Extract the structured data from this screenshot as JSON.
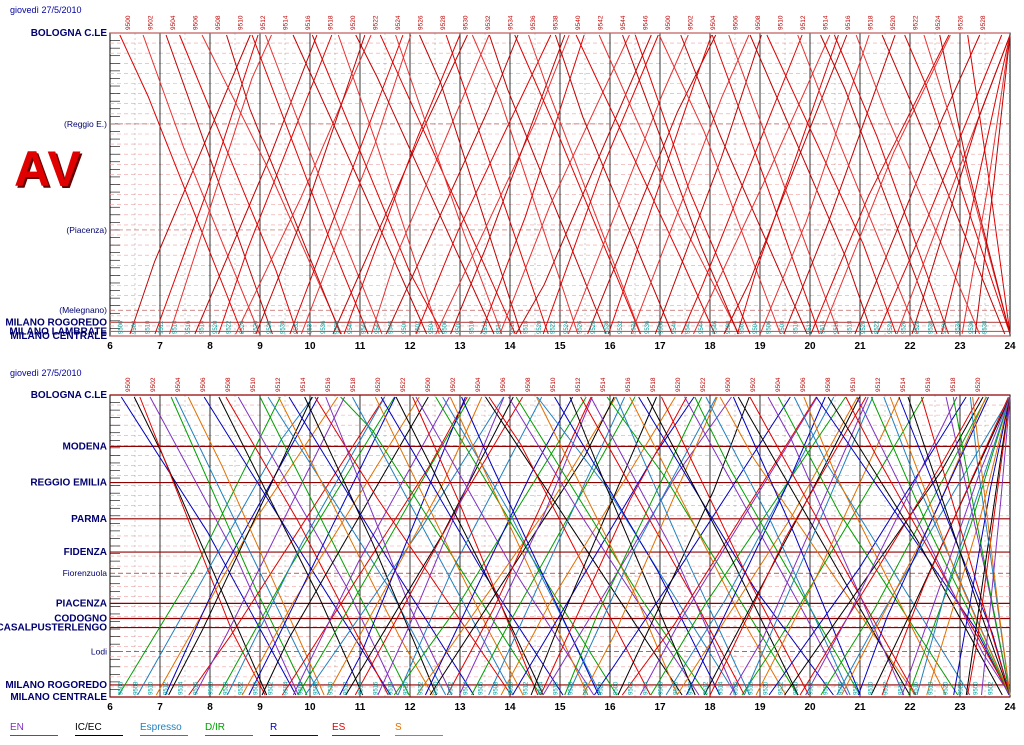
{
  "chart_data": [
    {
      "type": "line",
      "subtype": "train-timetable-diagram",
      "date_label": "giovedì 27/5/2010",
      "badge": "AV",
      "xlabel": "",
      "ylabel": "",
      "x_ticks": [
        "6",
        "7",
        "8",
        "9",
        "10",
        "11",
        "12",
        "13",
        "14",
        "15",
        "16",
        "17",
        "18",
        "19",
        "20",
        "21",
        "22",
        "23",
        "24"
      ],
      "xlim": [
        6,
        24
      ],
      "stations": [
        {
          "name": "BOLOGNA C.LE",
          "km": 0
        },
        {
          "name": "(Reggio E.)",
          "km": 0.3
        },
        {
          "name": "(Piacenza)",
          "km": 0.65
        },
        {
          "name": "(Melegnano)",
          "km": 0.915
        },
        {
          "name": "MILANO ROGOREDO",
          "km": 0.955
        },
        {
          "name": "MILANO LAMBRATE",
          "km": 0.985
        },
        {
          "name": "MILANO CENTRALE",
          "km": 1
        }
      ],
      "series": [
        {
          "name": "ES",
          "color": "#e00000",
          "trips": [
            6.8,
            7.2,
            7.6,
            8.0,
            8.3,
            8.7,
            9.0,
            9.3,
            9.6,
            10.0,
            10.3,
            10.6,
            11.0,
            11.3,
            11.6,
            12.0,
            12.4,
            13.0,
            13.4,
            13.8,
            14.2,
            14.6,
            15.0,
            15.4,
            15.8,
            16.2,
            16.6,
            17.0,
            17.4,
            17.8,
            18.2,
            18.6,
            19.0,
            19.4,
            19.8,
            20.2,
            20.6,
            21.0,
            21.4,
            21.8,
            22.2,
            22.6,
            23.0
          ]
        },
        {
          "name": "R",
          "color": "#2a7fd4",
          "trips": []
        }
      ],
      "train_labels": [
        "9500",
        "9502",
        "9504",
        "9506",
        "9508",
        "9510",
        "9512",
        "9514",
        "9516",
        "9518",
        "9520",
        "9522",
        "9524",
        "9526",
        "9528",
        "9530",
        "9532",
        "9534",
        "9536",
        "9538",
        "9540",
        "9542",
        "9544",
        "9546"
      ],
      "grid": true
    },
    {
      "type": "line",
      "subtype": "train-timetable-diagram",
      "date_label": "giovedì 27/5/2010",
      "x_ticks": [
        "6",
        "7",
        "8",
        "9",
        "10",
        "11",
        "12",
        "13",
        "14",
        "15",
        "16",
        "17",
        "18",
        "19",
        "20",
        "21",
        "22",
        "23",
        "24"
      ],
      "xlim": [
        6,
        24
      ],
      "stations": [
        {
          "name": "BOLOGNA C.LE",
          "km": 0
        },
        {
          "name": "MODENA",
          "km": 0.17
        },
        {
          "name": "REGGIO EMILIA",
          "km": 0.29
        },
        {
          "name": "PARMA",
          "km": 0.41
        },
        {
          "name": "FIDENZA",
          "km": 0.52
        },
        {
          "name": "Fiorenzuola",
          "km": 0.59
        },
        {
          "name": "PIACENZA",
          "km": 0.69
        },
        {
          "name": "CODOGNO",
          "km": 0.74
        },
        {
          "name": "CASALPUSTERLENGO",
          "km": 0.77
        },
        {
          "name": "Lodi",
          "km": 0.85
        },
        {
          "name": "MILANO ROGOREDO",
          "km": 0.96
        },
        {
          "name": "MILANO CENTRALE",
          "km": 1
        }
      ],
      "series": [
        {
          "name": "EN",
          "color": "#8030c0"
        },
        {
          "name": "IC/EC",
          "color": "#000000"
        },
        {
          "name": "Espresso",
          "color": "#2080c0"
        },
        {
          "name": "D/IR",
          "color": "#00a000"
        },
        {
          "name": "R",
          "color": "#0000c0"
        },
        {
          "name": "ES",
          "color": "#e00000"
        },
        {
          "name": "S",
          "color": "#e07000"
        }
      ],
      "grid": true
    }
  ],
  "legend": [
    {
      "label": "EN",
      "color": "#8030c0"
    },
    {
      "label": "IC/EC",
      "color": "#000000"
    },
    {
      "label": "Espresso",
      "color": "#2080c0"
    },
    {
      "label": "D/IR",
      "color": "#00a000"
    },
    {
      "label": "R",
      "color": "#0000c0"
    },
    {
      "label": "ES",
      "color": "#e00000"
    },
    {
      "label": "S",
      "color": "#e07000"
    }
  ]
}
